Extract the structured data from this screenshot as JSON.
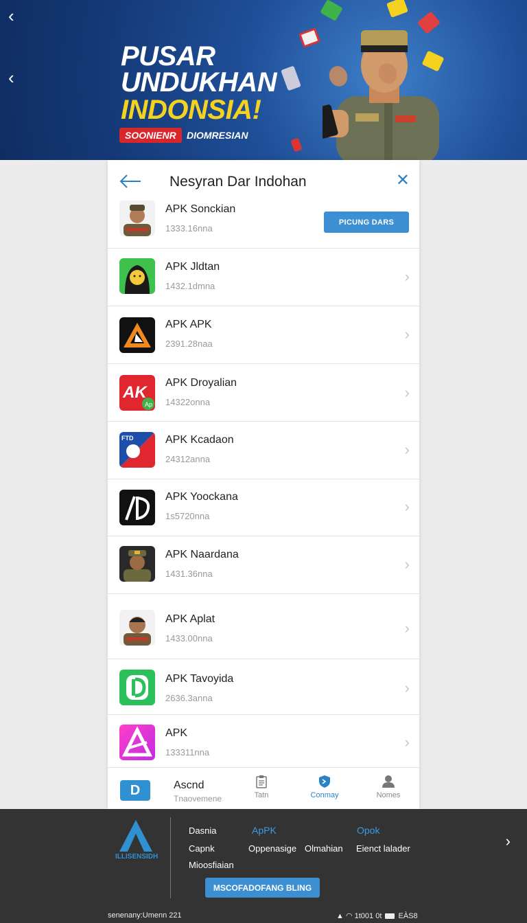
{
  "banner": {
    "title_line1": "PUSAR",
    "title_line2": "UNDUKHAN",
    "title_line3": "INDONSIA!",
    "badge": "SOONIENR",
    "subtitle": "DIOMRESIAN"
  },
  "dialog": {
    "title": "Nesyran Dar Indohan",
    "download_button": "PICUNG DARS",
    "apps": [
      {
        "name": "APK Sonckian",
        "size": "1333.16nna"
      },
      {
        "name": "APK Jldtan",
        "size": "1432.1dmna"
      },
      {
        "name": "APK APK",
        "size": "2391.28naa"
      },
      {
        "name": "APK Droyalian",
        "size": "14322onna"
      },
      {
        "name": "APK Kcadaon",
        "size": "24312anna"
      },
      {
        "name": "APK Yoockana",
        "size": "1s5720nna"
      },
      {
        "name": "APK Naardana",
        "size": "1431.36nna"
      },
      {
        "name": "APK Aplat",
        "size": "1433.00nna"
      },
      {
        "name": "APK Tavoyida",
        "size": "2636.3anna"
      },
      {
        "name": "APK",
        "size": "133311nna"
      }
    ]
  },
  "bottom_nav": {
    "brand_name": "Ascnd",
    "brand_sub": "Tnaovemene",
    "tabs": [
      {
        "label": "Tatn",
        "icon": "clipboard-icon"
      },
      {
        "label": "Conmay",
        "icon": "shield-icon"
      },
      {
        "label": "Nomes",
        "icon": "person-icon"
      }
    ],
    "active_tab": "Conmay"
  },
  "footer": {
    "logo_text": "ILLISENSIDH",
    "links": {
      "col1": [
        "Dasnia",
        "Capnk",
        "Mioosfiaian"
      ],
      "col2_header": "ApPK",
      "col2": [
        "Oppenasige"
      ],
      "col3": [
        "Olmahian"
      ],
      "col4_header": "Opok",
      "col4": [
        "Eienct lalader"
      ]
    },
    "cta_button": "MSCOFADOFANG BLING",
    "bottom_left": "senenany:Umenn 221",
    "bottom_right": "1t001 0t",
    "battery_text": "EÀS8"
  },
  "colors": {
    "accent": "#3b8fd2",
    "banner_bg": "#1f4f98",
    "footer_bg": "#333333",
    "badge_red": "#d8262b",
    "title_yellow": "#f4d21f"
  }
}
